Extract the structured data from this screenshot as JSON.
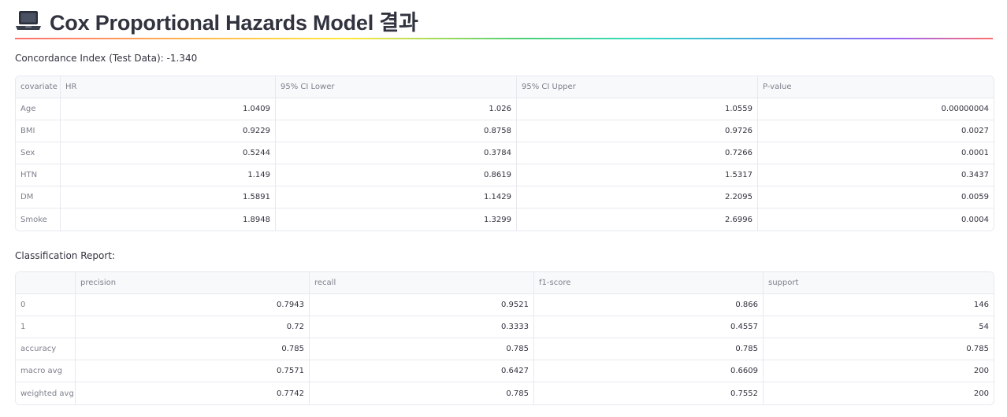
{
  "title": {
    "icon": "laptop-icon",
    "text": "Cox Proportional Hazards Model 결과"
  },
  "concordance_label": "Concordance Index (Test Data): -1.340",
  "cox_table": {
    "headers": [
      "covariate",
      "HR",
      "95% CI Lower",
      "95% CI Upper",
      "P-value"
    ],
    "rows": [
      [
        "Age",
        "1.0409",
        "1.026",
        "1.0559",
        "0.00000004"
      ],
      [
        "BMI",
        "0.9229",
        "0.8758",
        "0.9726",
        "0.0027"
      ],
      [
        "Sex",
        "0.5244",
        "0.3784",
        "0.7266",
        "0.0001"
      ],
      [
        "HTN",
        "1.149",
        "0.8619",
        "1.5317",
        "0.3437"
      ],
      [
        "DM",
        "1.5891",
        "1.1429",
        "2.2095",
        "0.0059"
      ],
      [
        "Smoke",
        "1.8948",
        "1.3299",
        "2.6996",
        "0.0004"
      ]
    ]
  },
  "classification_label": "Classification Report:",
  "report_table": {
    "headers": [
      "",
      "precision",
      "recall",
      "f1-score",
      "support"
    ],
    "rows": [
      [
        "0",
        "0.7943",
        "0.9521",
        "0.866",
        "146"
      ],
      [
        "1",
        "0.72",
        "0.3333",
        "0.4557",
        "54"
      ],
      [
        "accuracy",
        "0.785",
        "0.785",
        "0.785",
        "0.785"
      ],
      [
        "macro avg",
        "0.7571",
        "0.6427",
        "0.6609",
        "200"
      ],
      [
        "weighted avg",
        "0.7742",
        "0.785",
        "0.7552",
        "200"
      ]
    ]
  }
}
